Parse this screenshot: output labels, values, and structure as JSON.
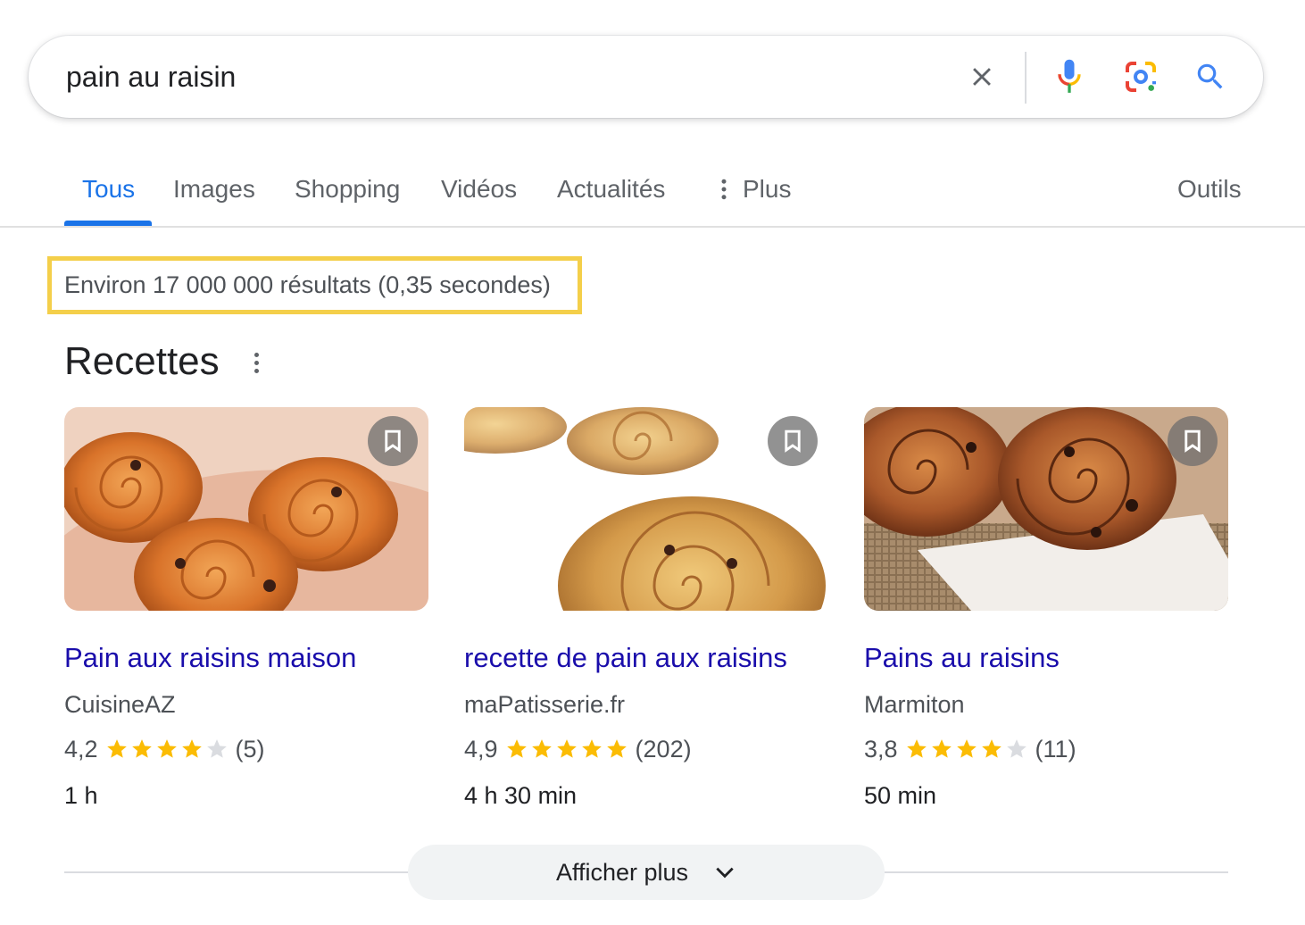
{
  "search": {
    "query": "pain au raisin",
    "icons": [
      "close-icon",
      "mic-icon",
      "lens-icon",
      "search-icon"
    ]
  },
  "tabs": [
    {
      "label": "Tous",
      "active": true
    },
    {
      "label": "Images"
    },
    {
      "label": "Shopping"
    },
    {
      "label": "Vidéos"
    },
    {
      "label": "Actualités"
    },
    {
      "label": "Plus",
      "icon": "more-vert-icon"
    },
    {
      "label": "Outils"
    }
  ],
  "results_stats": "Environ 17 000 000 résultats (0,35 secondes)",
  "recipes": {
    "title": "Recettes",
    "cards": [
      {
        "title": "Pain aux raisins maison",
        "source": "CuisineAZ",
        "rating": "4,2",
        "stars": 4.2,
        "reviews": "(5)",
        "time": "1 h"
      },
      {
        "title": "recette de pain aux raisins",
        "source": "maPatisserie.fr",
        "rating": "4,9",
        "stars": 4.9,
        "reviews": "(202)",
        "time": "4 h 30 min"
      },
      {
        "title": "Pains au raisins",
        "source": "Marmiton",
        "rating": "3,8",
        "stars": 3.8,
        "reviews": "(11)",
        "time": "50 min"
      }
    ],
    "show_more": "Afficher plus"
  },
  "colors": {
    "accent": "#1a73e8",
    "link": "#1a0dab",
    "star": "#fbbc04",
    "highlight": "#f4cf4a"
  }
}
